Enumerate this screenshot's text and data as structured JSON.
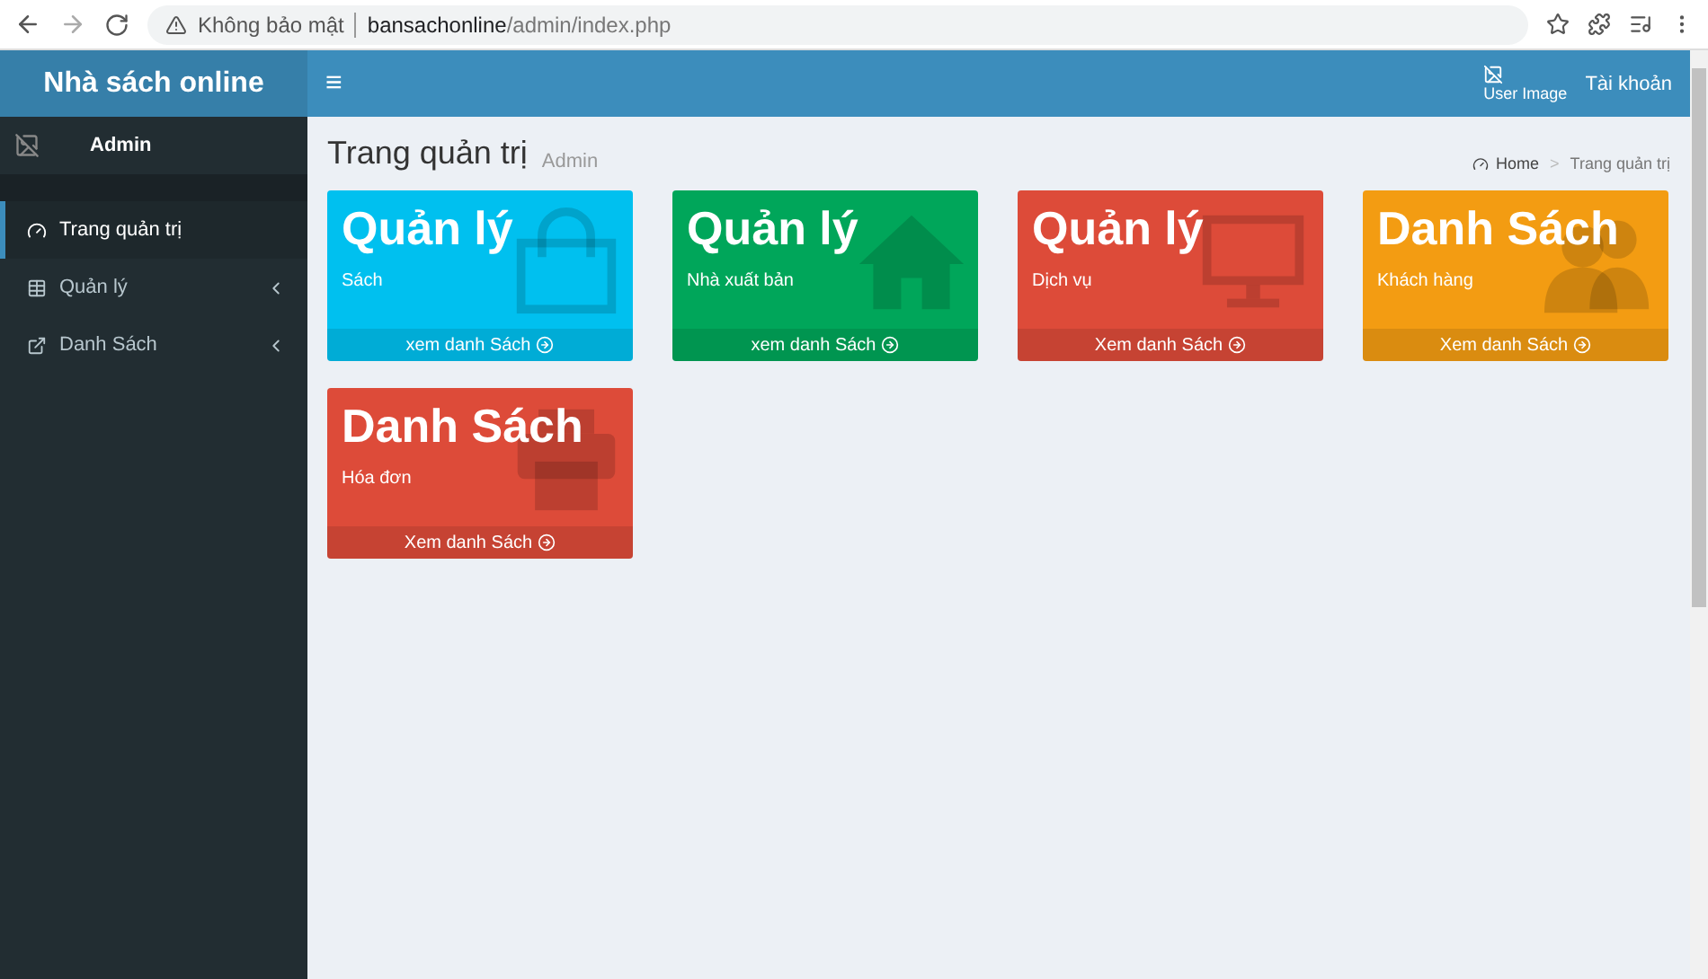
{
  "browser": {
    "security": "Không bảo mật",
    "url_host": "bansachonline",
    "url_path": "/admin/index.php"
  },
  "sidebar": {
    "logo": "Nhà sách online",
    "user": "Admin",
    "items": [
      {
        "label": "Trang quản trị",
        "kind": "dashboard",
        "selected": true
      },
      {
        "label": "Quản lý",
        "kind": "table",
        "selected": false,
        "expanded": false
      },
      {
        "label": "Danh Sách",
        "kind": "external",
        "selected": false,
        "expanded": false
      }
    ]
  },
  "header": {
    "menu_toggle": "≡",
    "user_image_alt": "User Image",
    "account": "Tài khoản"
  },
  "page": {
    "title": "Trang quản trị",
    "subtitle": "Admin",
    "breadcrumb": [
      "Home",
      "Trang quản trị"
    ],
    "breadcrumb_separator": ">"
  },
  "cards": [
    {
      "title": "Quản lý",
      "subtitle": "Sách",
      "link": "xem danh Sách",
      "color": "#00c0ef",
      "kind": "bag"
    },
    {
      "title": "Quản lý",
      "subtitle": "Nhà xuất bản",
      "link": "xem danh Sách",
      "color": "#00a65a",
      "kind": "home"
    },
    {
      "title": "Quản lý",
      "subtitle": "Dịch vụ",
      "link": "Xem danh Sách",
      "color": "#dd4b39",
      "kind": "monitor"
    },
    {
      "title": "Danh Sách",
      "subtitle": "Khách hàng",
      "link": "Xem danh Sách",
      "color": "#f39c12",
      "kind": "users"
    },
    {
      "title": "Danh Sách",
      "subtitle": "Hóa đơn",
      "link": "Xem danh Sách",
      "color": "#dd4b39",
      "kind": "print"
    }
  ]
}
